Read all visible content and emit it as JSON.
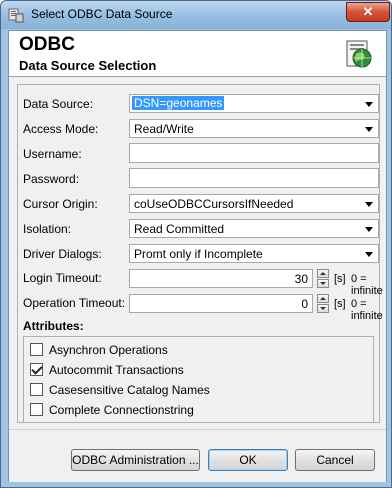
{
  "window": {
    "title": "Select ODBC Data Source",
    "close_glyph": "✕"
  },
  "header": {
    "title": "ODBC",
    "subtitle": "Data Source Selection"
  },
  "fields": {
    "data_source": {
      "label": "Data Source:",
      "value": "DSN=geonames"
    },
    "access_mode": {
      "label": "Access Mode:",
      "value": "Read/Write"
    },
    "username": {
      "label": "Username:",
      "value": ""
    },
    "password": {
      "label": "Password:",
      "value": ""
    },
    "cursor_origin": {
      "label": "Cursor Origin:",
      "value": "coUseODBCCursorsIfNeeded"
    },
    "isolation": {
      "label": "Isolation:",
      "value": "Read Committed"
    },
    "driver_dialogs": {
      "label": "Driver Dialogs:",
      "value": "Promt only if Incomplete"
    },
    "login_timeout": {
      "label": "Login Timeout:",
      "value": "30",
      "unit": "[s]",
      "hint": "0 = infinite"
    },
    "operation_timeout": {
      "label": "Operation Timeout:",
      "value": "0",
      "unit": "[s]",
      "hint": "0 = infinite"
    }
  },
  "attributes": {
    "label": "Attributes:",
    "items": [
      {
        "label": "Asynchron Operations",
        "checked": false
      },
      {
        "label": "Autocommit Transactions",
        "checked": true
      },
      {
        "label": "Casesensitive Catalog Names",
        "checked": false
      },
      {
        "label": "Complete Connectionstring",
        "checked": false
      }
    ]
  },
  "buttons": {
    "admin": "ODBC Administration ...",
    "ok": "OK",
    "cancel": "Cancel"
  },
  "icons": {
    "title": "odbc-app-icon",
    "header": "database-globe-icon"
  }
}
